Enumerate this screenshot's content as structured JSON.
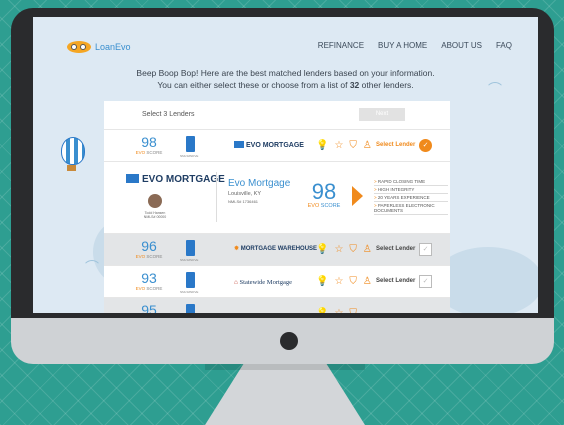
{
  "brand": {
    "name": "LoanEvo"
  },
  "nav": [
    "REFINANCE",
    "BUY A HOME",
    "ABOUT US",
    "FAQ"
  ],
  "headline": {
    "line1": "Beep Boop Bop! Here are the best matched lenders based on your information.",
    "line2_pre": "You can either select these or choose from a list of ",
    "line2_count": "32",
    "line2_post": " other lenders."
  },
  "panel": {
    "select_label": "Select 3 Lenders",
    "next_label": "Next"
  },
  "score_label": {
    "evo": "EVO",
    "score": "SCORE"
  },
  "doc_label": "NMLS#NDVE",
  "rows": [
    {
      "score": "98",
      "lender": "EVO MORTGAGE",
      "select": "Select Lender",
      "selected": true
    },
    {
      "score": "96",
      "lender": "MORTGAGE WAREHOUSE",
      "select": "Select Lender",
      "selected": false
    },
    {
      "score": "93",
      "lender": "Statewide Mortgage",
      "select": "Select Lender",
      "selected": false
    },
    {
      "score": "95",
      "lender": "",
      "select": "",
      "selected": false
    }
  ],
  "detail": {
    "logo": "EVO MORTGAGE",
    "person_name": "Todd Hansen",
    "person_nmls": "NMLS# 00000",
    "name": "Evo Mortgage",
    "location": "Louisville, KY",
    "nmls": "NMLS# 1736461",
    "score": "98",
    "score_evo": "EVO",
    "score_word": "SCORE",
    "features": [
      "RAPID CLOSING TIME",
      "HIGH INTEGRITY",
      "20 YEARS EXPERIENCE",
      "PAPERLESS ELECTRONIC DOCUMENTS"
    ]
  },
  "icons": [
    "bulb-icon",
    "star-icon",
    "shield-icon",
    "person-icon"
  ],
  "colors": {
    "accent_blue": "#3a8fcf",
    "accent_orange": "#f08a1c",
    "background_teal": "#2e9e91"
  }
}
